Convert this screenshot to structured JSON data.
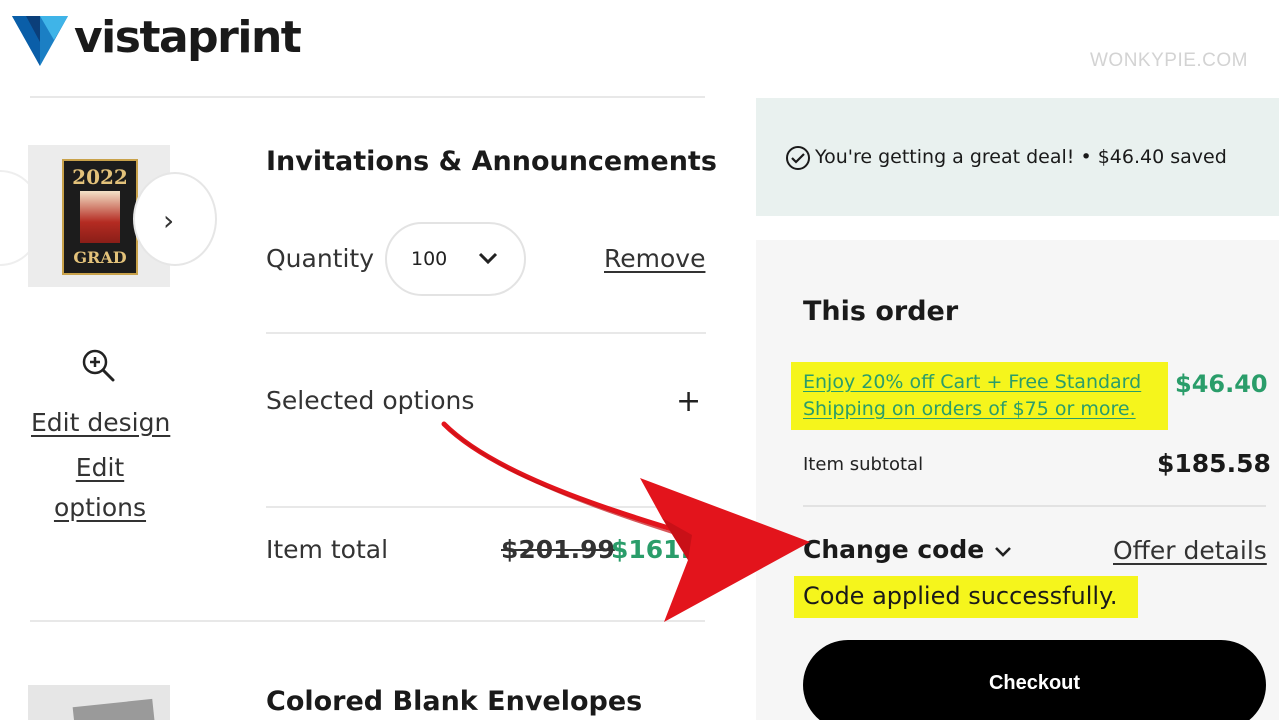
{
  "header": {
    "brand": "vistaprint",
    "watermark": "WONKYPIE.COM"
  },
  "colors": {
    "accent_green": "#2a9d6a",
    "highlight_yellow": "#f5f51c",
    "arrow_red": "#e3141c",
    "deal_bg": "#e9f1ef"
  },
  "product": {
    "thumb_card": {
      "year": "2022",
      "caption": "GRAD"
    },
    "title": "Invitations & Announcements",
    "zoom_icon": "zoom-in-icon",
    "edit_design": "Edit design",
    "edit_options": "Edit options",
    "quantity_label": "Quantity",
    "quantity_value": "100",
    "remove": "Remove",
    "selected_options": "Selected options",
    "plus": "+",
    "item_total_label": "Item total",
    "price_original": "$201.99",
    "price_discounted": "$161.59",
    "carousel_next": "›"
  },
  "product2": {
    "title": "Colored Blank Envelopes"
  },
  "summary": {
    "deal_text": "You're getting a great deal! • $46.40 saved",
    "order_title": "This order",
    "promo_text": "Enjoy 20% off Cart + Free Standard Shipping on orders of $75 or more.",
    "promo_amount": "$46.40",
    "subtotal_label": "Item subtotal",
    "subtotal_amount": "$185.58",
    "change_code": "Change code",
    "offer_details": "Offer details",
    "code_status": "Code applied successfully.",
    "checkout": "Checkout"
  }
}
